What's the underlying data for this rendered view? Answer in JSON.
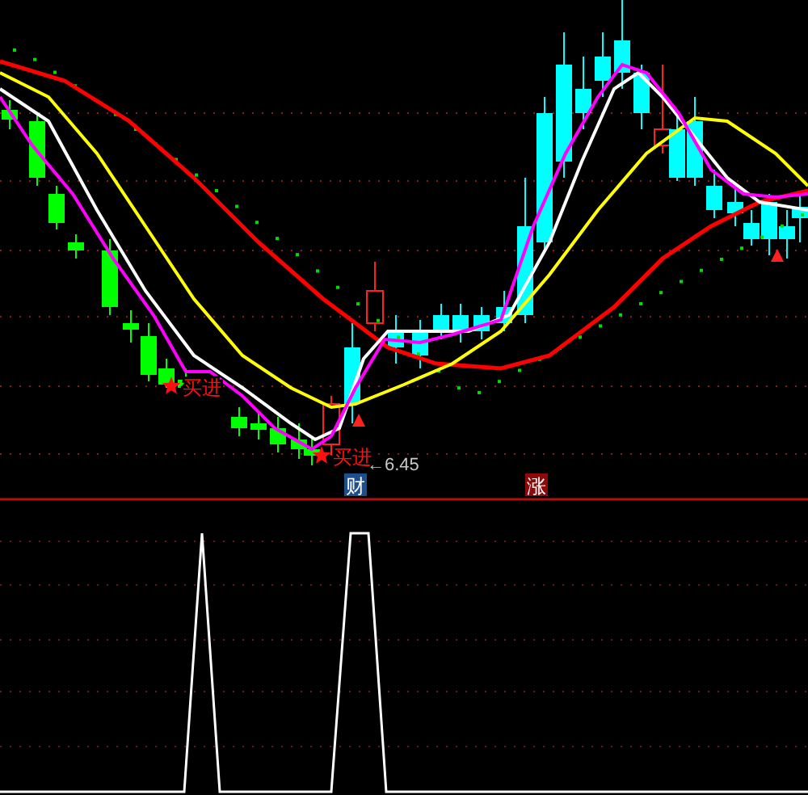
{
  "price_chart": {
    "signals": [
      {
        "label": "买进"
      },
      {
        "label": "买进"
      }
    ],
    "low_price_label": "←6.45"
  },
  "event_markers": [
    {
      "label": "财",
      "kind": "finance"
    },
    {
      "label": "涨",
      "kind": "rise"
    }
  ]
}
